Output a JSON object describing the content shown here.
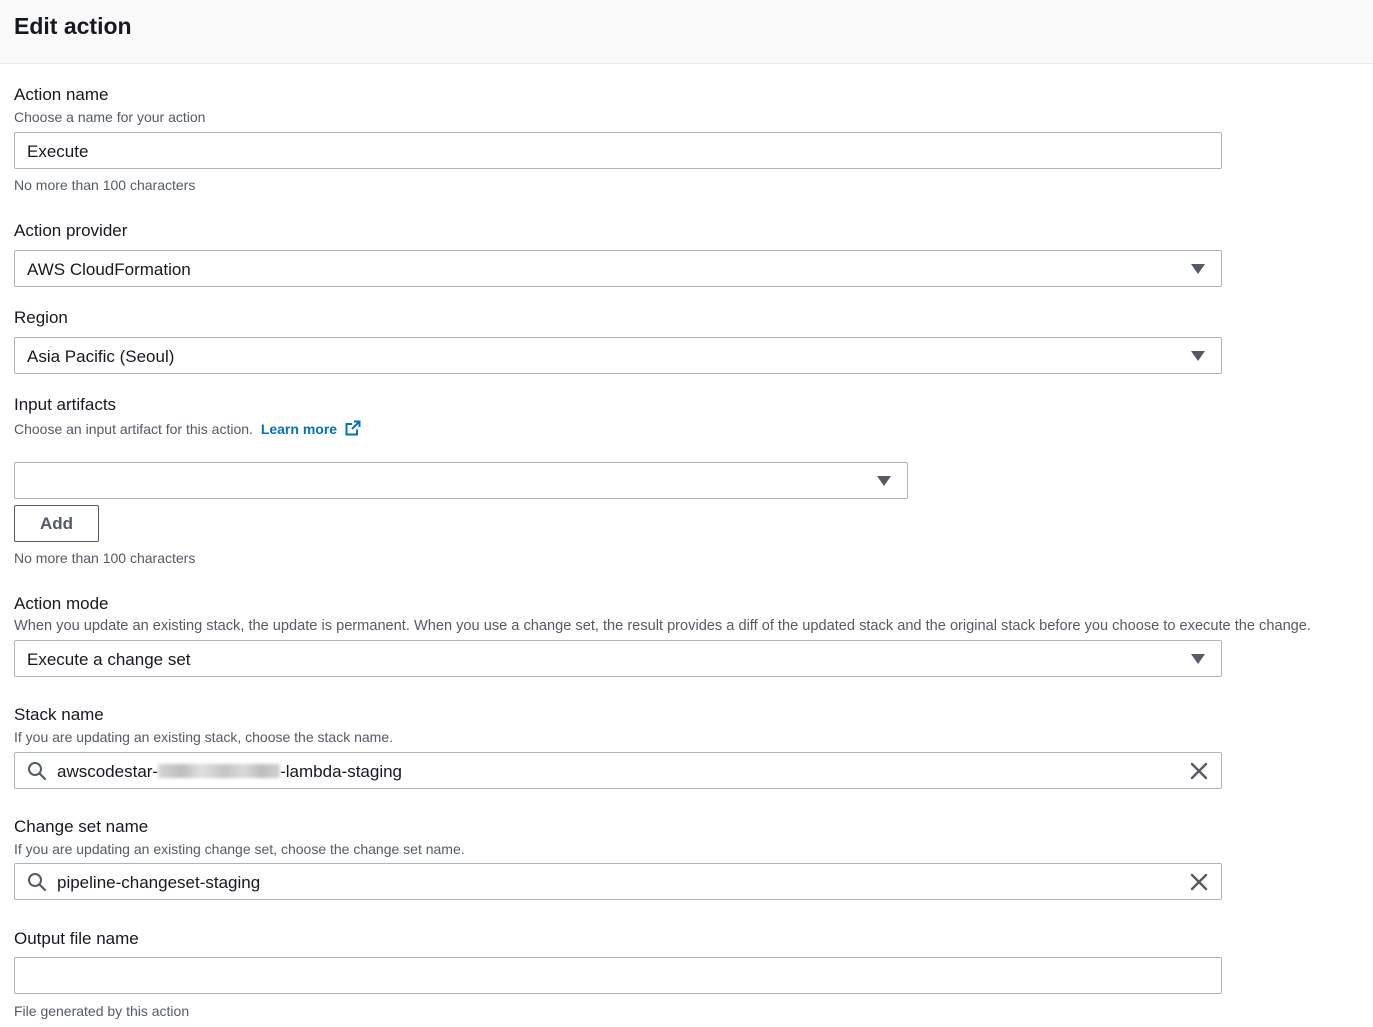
{
  "header": {
    "title": "Edit action"
  },
  "action_name": {
    "label": "Action name",
    "description": "Choose a name for your action",
    "value": "Execute",
    "constraint": "No more than 100 characters"
  },
  "action_provider": {
    "label": "Action provider",
    "selected": "AWS CloudFormation"
  },
  "region": {
    "label": "Region",
    "selected": "Asia Pacific (Seoul)"
  },
  "input_artifacts": {
    "label": "Input artifacts",
    "description": "Choose an input artifact for this action.",
    "learn_more": "Learn more",
    "selected": "",
    "add_button": "Add",
    "constraint": "No more than 100 characters"
  },
  "action_mode": {
    "label": "Action mode",
    "description": "When you update an existing stack, the update is permanent. When you use a change set, the result provides a diff of the updated stack and the original stack before you choose to execute the change.",
    "selected": "Execute a change set"
  },
  "stack_name": {
    "label": "Stack name",
    "description": "If you are updating an existing stack, choose the stack name.",
    "value_prefix": "awscodestar-",
    "value_suffix": "-lambda-staging"
  },
  "change_set_name": {
    "label": "Change set name",
    "description": "If you are updating an existing change set, choose the change set name.",
    "value": "pipeline-changeset-staging"
  },
  "output_file_name": {
    "label": "Output file name",
    "value": "",
    "constraint": "File generated by this action"
  },
  "icons": {
    "dropdown": "caret-down-icon",
    "search": "search-icon",
    "clear": "close-icon",
    "external": "external-link-icon"
  },
  "colors": {
    "link": "#0073bb",
    "text": "#16191f",
    "secondary": "#545b64",
    "border": "#aab7b8"
  }
}
